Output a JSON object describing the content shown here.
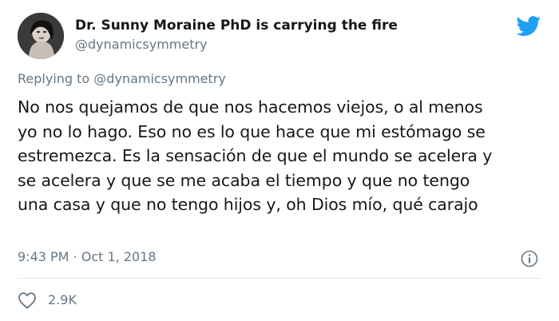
{
  "author": {
    "name": "Dr. Sunny Moraine PhD is carrying the fire",
    "handle": "@dynamicsymmetry",
    "avatar_icon": "profile-photo"
  },
  "brand_icon": "twitter-bird-icon",
  "brand_color": "#1da1f2",
  "reply": {
    "label": "Replying to",
    "handle": "@dynamicsymmetry"
  },
  "tweet": {
    "lines": [
      "No nos quejamos de que nos hacemos viejos, o al menos",
      "yo no lo hago. Eso no es lo que hace que mi estómago se",
      "estremezca. Es la sensación de que el mundo se acelera y",
      "se acelera y que se me acaba el tiempo y que no tengo",
      "una casa y que no tengo hijos y, oh Dios mío, qué carajo"
    ]
  },
  "meta": {
    "time": "9:43 PM",
    "separator": "·",
    "date": "Oct 1, 2018",
    "info_icon": "info-icon"
  },
  "engagement": {
    "like_icon": "heart-outline-icon",
    "likes": "2.9K"
  }
}
